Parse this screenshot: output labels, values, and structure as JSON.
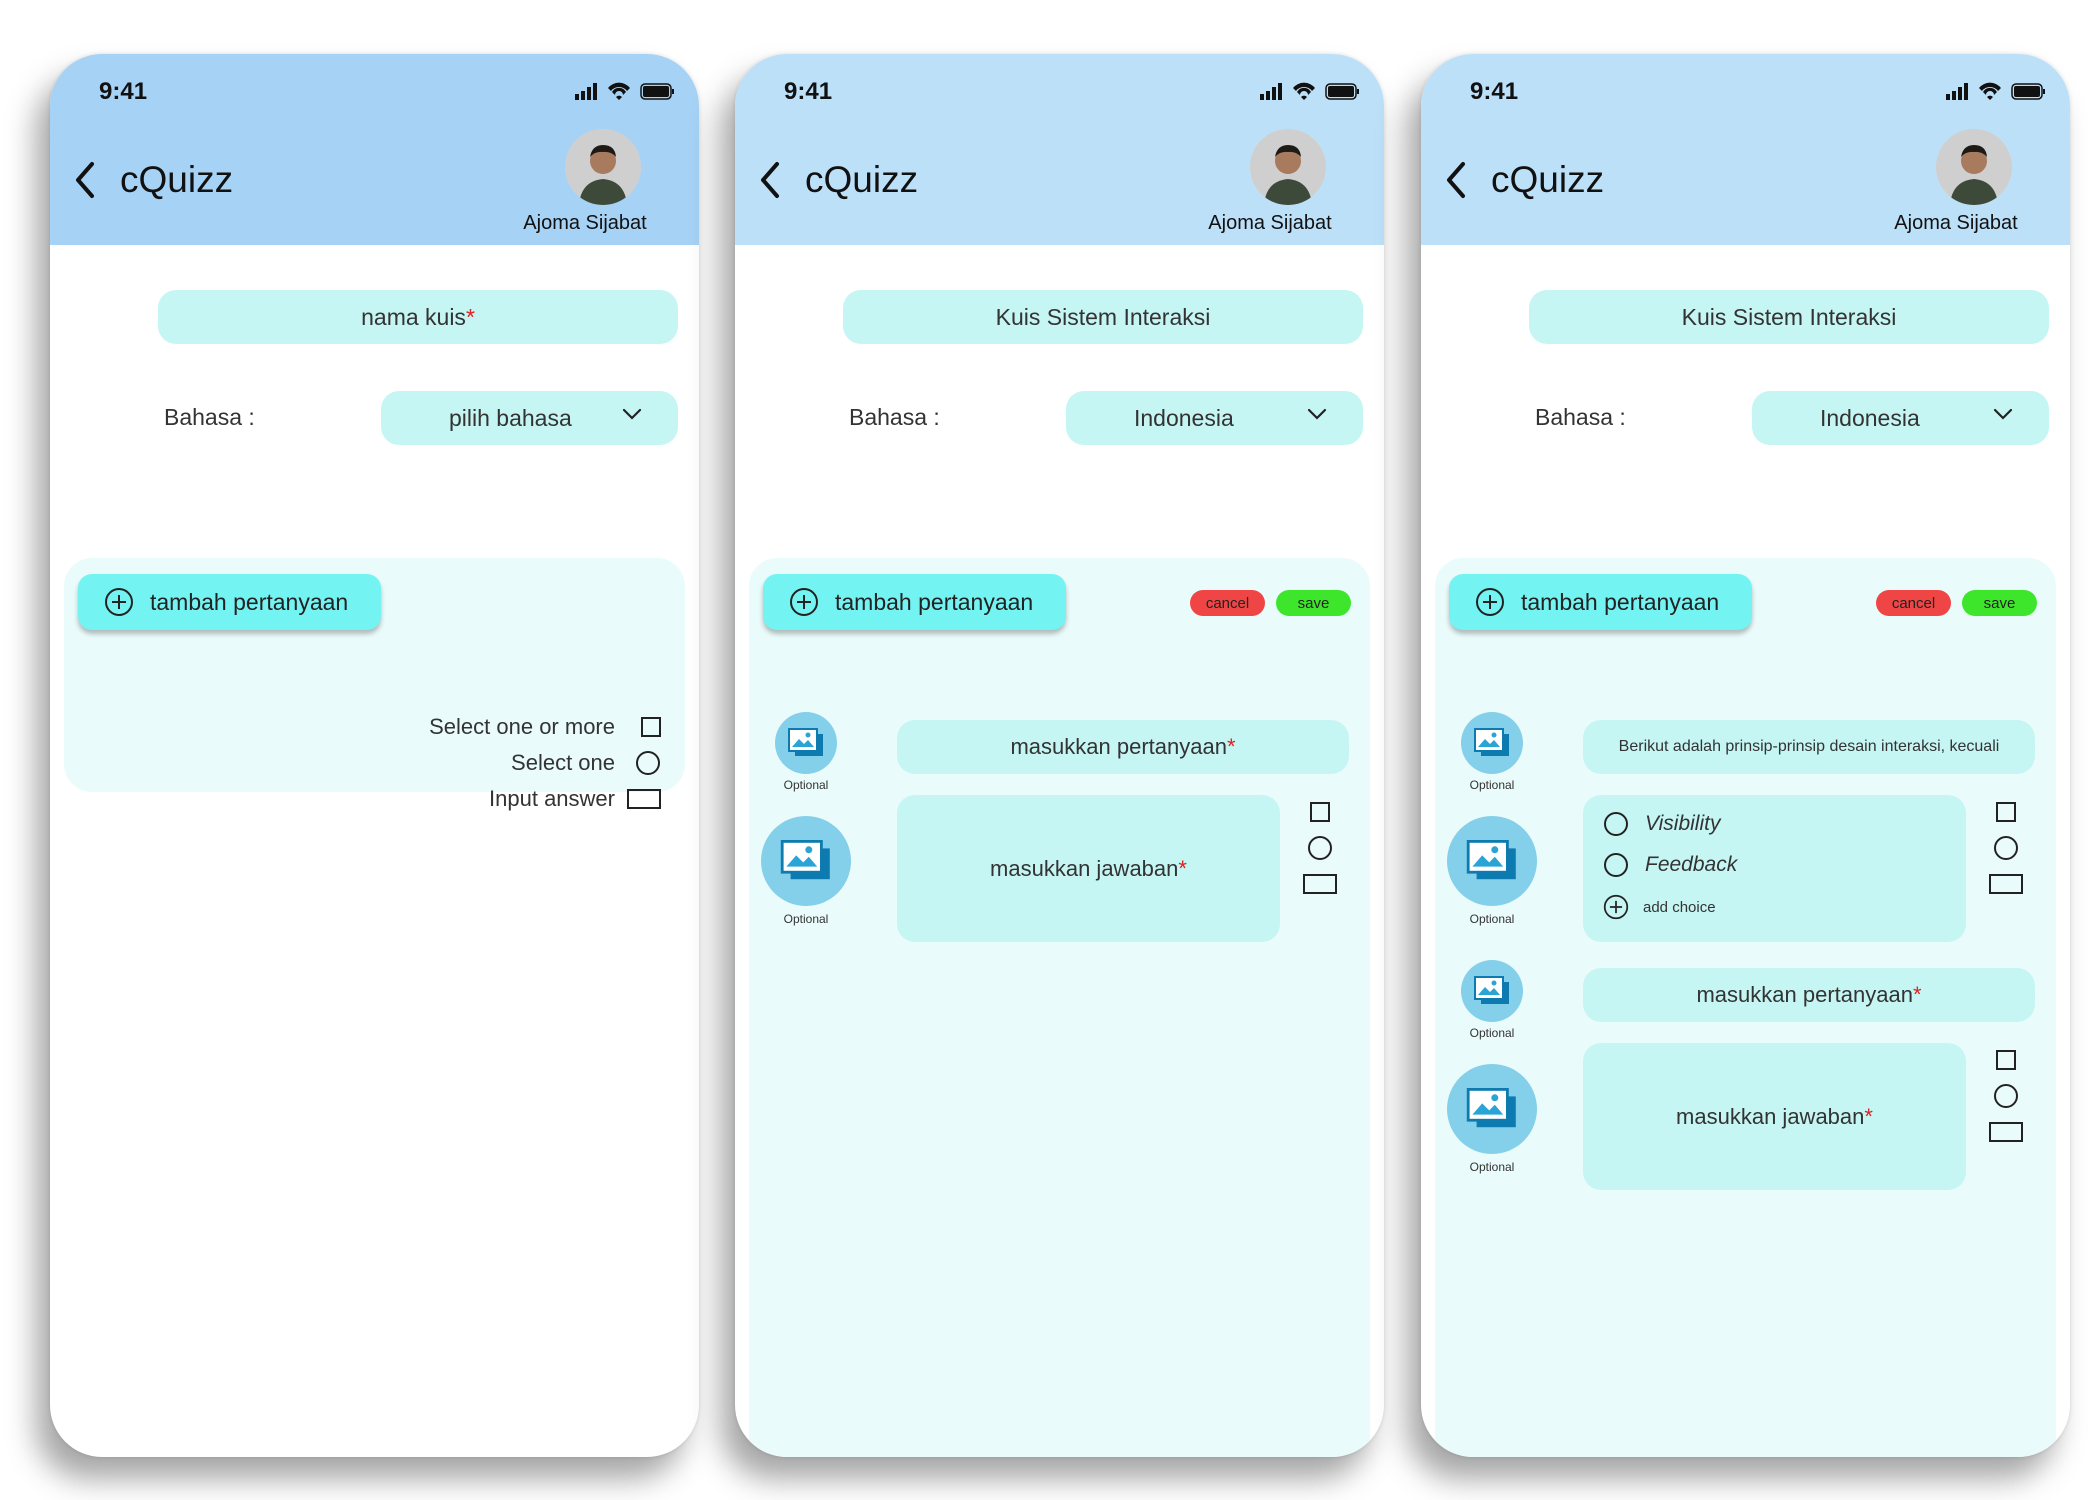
{
  "status_bar": {
    "time": "9:41"
  },
  "header": {
    "back_icon": "chevron-left-icon",
    "app_title": "cQuizz",
    "user_name": "Ajoma Sijabat"
  },
  "screens": [
    {
      "quiz_name": "nama kuis",
      "quiz_name_required": "*",
      "language_label": "Bahasa :",
      "language_value": "pilih bahasa",
      "add_question_label": "tambah pertanyaan",
      "answer_types": [
        {
          "label": "Select one or more",
          "icon": "checkbox-icon"
        },
        {
          "label": "Select one",
          "icon": "radio-icon"
        },
        {
          "label": "Input answer",
          "icon": "text-input-icon"
        }
      ]
    },
    {
      "quiz_name": "Kuis Sistem Interaksi",
      "language_label": "Bahasa :",
      "language_value": "Indonesia",
      "add_question_label": "tambah pertanyaan",
      "cancel_label": "cancel",
      "save_label": "save",
      "optional_label": "Optional",
      "question_placeholder": "masukkan pertanyaan",
      "answer_placeholder": "masukkan jawaban",
      "required_mark": "*"
    },
    {
      "quiz_name": "Kuis Sistem Interaksi",
      "language_label": "Bahasa :",
      "language_value": "Indonesia",
      "add_question_label": "tambah pertanyaan",
      "cancel_label": "cancel",
      "save_label": "save",
      "optional_label": "Optional",
      "question_1_text": "Berikut adalah prinsip-prinsip desain interaksi, kecuali",
      "choices": [
        "Visibility",
        "Feedback"
      ],
      "add_choice_label": "add choice",
      "question_placeholder": "masukkan pertanyaan",
      "answer_placeholder": "masukkan jawaban",
      "required_mark": "*"
    }
  ],
  "colors": {
    "header_blue": "#a5d2f5",
    "field_cyan": "#c5f6f4",
    "button_cyan": "#74f3f3",
    "editor_bg": "#eafbfb",
    "cancel_red": "#f04545",
    "save_green": "#3ee62b",
    "required_red": "#e02020"
  }
}
